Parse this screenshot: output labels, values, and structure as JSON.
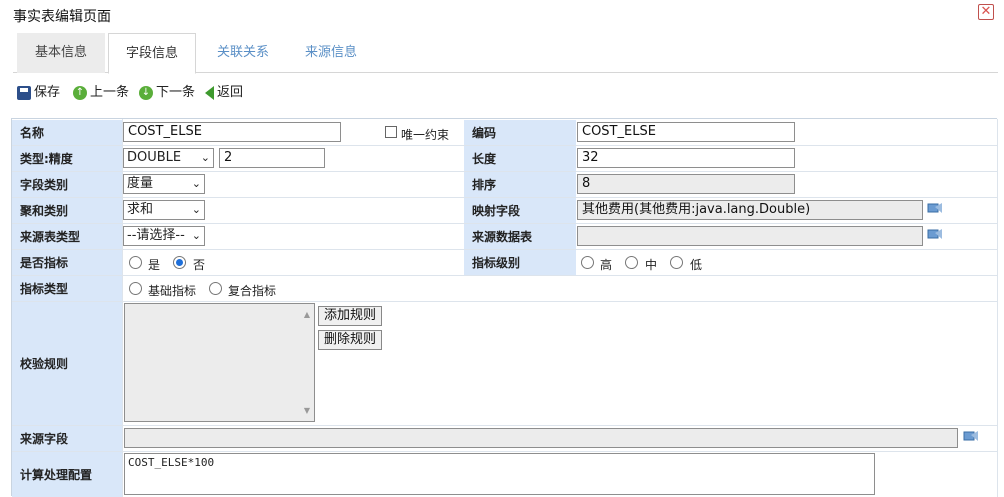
{
  "window": {
    "title": "事实表编辑页面",
    "close": "✕"
  },
  "tabs": [
    {
      "label": "基本信息"
    },
    {
      "label": "字段信息"
    },
    {
      "label": "关联关系"
    },
    {
      "label": "来源信息"
    }
  ],
  "toolbar": {
    "save": "保存",
    "prev": "上一条",
    "next": "下一条",
    "back": "返回",
    "prev_icon": "↑",
    "next_icon": "↓"
  },
  "form": {
    "name": {
      "label": "名称",
      "value": "COST_ELSE"
    },
    "unique": {
      "label": "唯一约束",
      "checked": false
    },
    "code": {
      "label": "编码",
      "value": "COST_ELSE"
    },
    "type": {
      "label": "类型:精度",
      "value": "DOUBLE",
      "precision": "2"
    },
    "length": {
      "label": "长度",
      "value": "32"
    },
    "field_category": {
      "label": "字段类别",
      "value": "度量"
    },
    "sort": {
      "label": "排序",
      "value": "8"
    },
    "agg": {
      "label": "聚和类别",
      "value": "求和"
    },
    "mapping": {
      "label": "映射字段",
      "value": "其他费用(其他费用:java.lang.Double)"
    },
    "source_table_type": {
      "label": "来源表类型",
      "value": "--请选择--"
    },
    "source_data_table": {
      "label": "来源数据表",
      "value": ""
    },
    "is_indicator": {
      "label": "是否指标",
      "options": [
        "是",
        "否"
      ],
      "selected": "否"
    },
    "indicator_level": {
      "label": "指标级别",
      "options": [
        "高",
        "中",
        "低"
      ],
      "selected": ""
    },
    "indicator_type": {
      "label": "指标类型",
      "options": [
        "基础指标",
        "复合指标"
      ],
      "selected": ""
    },
    "validation": {
      "label": "校验规则",
      "add_btn": "添加规则",
      "del_btn": "删除规则"
    },
    "source_field": {
      "label": "来源字段",
      "value": ""
    },
    "calc": {
      "label": "计算处理配置",
      "value": "COST_ELSE*100"
    }
  },
  "colors": {
    "label_bg": "#d9e7f9",
    "tab_link": "#5a8fc6",
    "close_red": "#d9534f"
  }
}
